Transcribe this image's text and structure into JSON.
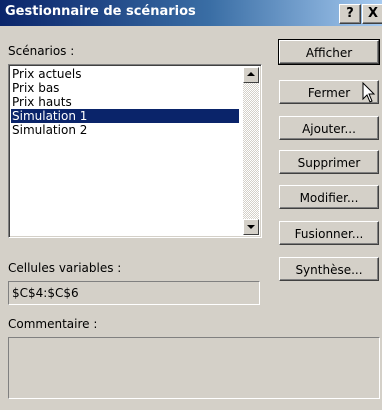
{
  "window": {
    "title": "Gestionnaire de scénarios",
    "help_label": "?",
    "close_label": "X"
  },
  "scenarios": {
    "label": "Scénarios :",
    "items": [
      {
        "label": "Prix actuels",
        "selected": false
      },
      {
        "label": "Prix bas",
        "selected": false
      },
      {
        "label": "Prix hauts",
        "selected": false
      },
      {
        "label": "Simulation 1",
        "selected": true
      },
      {
        "label": "Simulation 2",
        "selected": false
      }
    ]
  },
  "buttons": {
    "show": "Afficher",
    "close": "Fermer",
    "add": "Ajouter...",
    "delete": "Supprimer",
    "edit": "Modifier...",
    "merge": "Fusionner...",
    "summary": "Synthèse..."
  },
  "changing_cells": {
    "label": "Cellules variables :",
    "value": "$C$4:$C$6"
  },
  "comment": {
    "label": "Commentaire :",
    "value": ""
  },
  "colors": {
    "selection": "#0a246a",
    "dialog_bg": "#d4d0c8"
  }
}
